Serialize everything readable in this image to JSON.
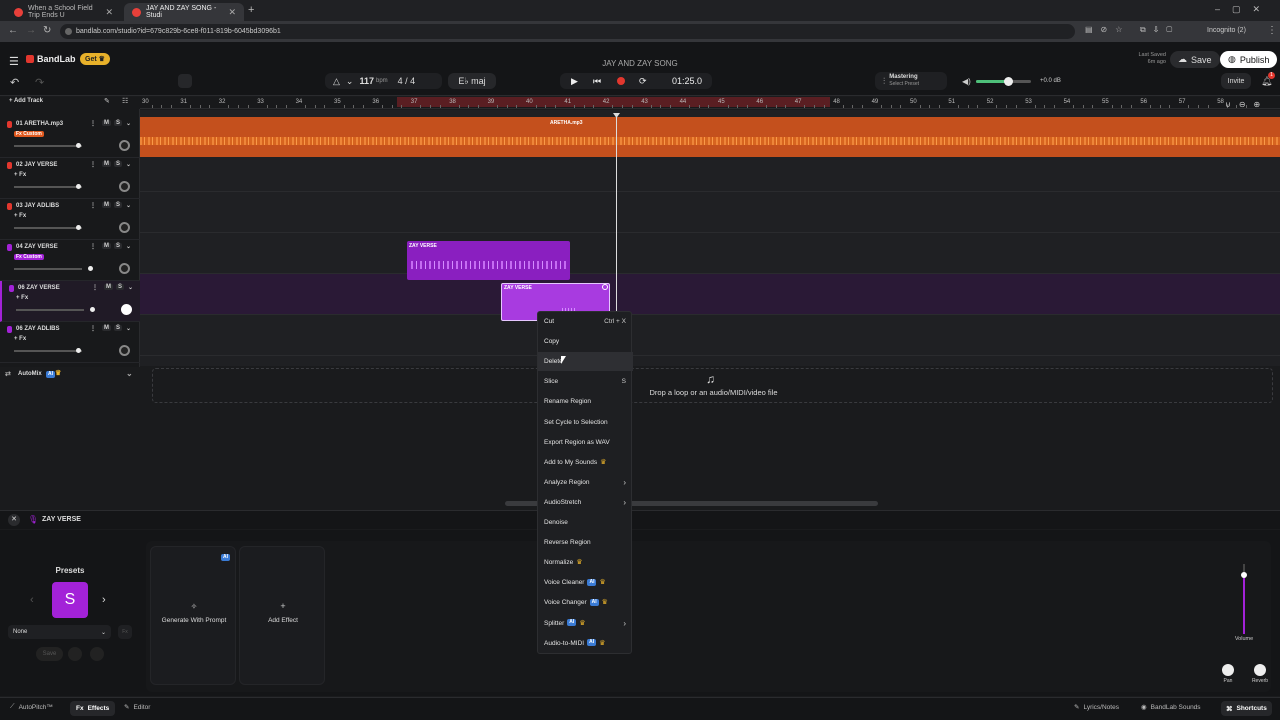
{
  "browser": {
    "tabs": [
      {
        "title": "When a School Field Trip Ends U"
      },
      {
        "title": "JAY AND ZAY SONG - Studi"
      }
    ],
    "url": "bandlab.com/studio?id=679c829b-6ce8-f011-819b-6045bd3096b1",
    "incognito": "Incognito (2)"
  },
  "header": {
    "brand": "BandLab",
    "get_label": "Get",
    "song_title": "JAY AND ZAY SONG",
    "tempo": "117",
    "tempo_unit": "bpm",
    "time_sig": "4 / 4",
    "key": "E♭ maj",
    "time": "01:25.0",
    "mastering_label": "Mastering",
    "mastering_preset": "Select Preset",
    "volume_db": "+0.0 dB",
    "last_saved_label": "Last Saved",
    "last_saved_value": "6m ago",
    "save_label": "Save",
    "publish_label": "Publish",
    "invite_label": "Invite",
    "notif_count": "1"
  },
  "add_track_label": "Add Track",
  "ruler": [
    "30",
    "31",
    "32",
    "33",
    "34",
    "35",
    "36",
    "37",
    "38",
    "39",
    "40",
    "41",
    "42",
    "43",
    "44",
    "45",
    "46",
    "47",
    "48",
    "49",
    "50",
    "51",
    "52",
    "53",
    "54",
    "55",
    "56",
    "57",
    "58"
  ],
  "tracks": [
    {
      "name": "01  ARETHA.mp3",
      "fx": "Fx Custom",
      "color": "#e0591f"
    },
    {
      "name": "02  JAY VERSE",
      "fx": "+ Fx",
      "color": "#e0591f"
    },
    {
      "name": "03  JAY ADLIBS",
      "fx": "+ Fx",
      "color": "#e0591f"
    },
    {
      "name": "04  ZAY VERSE",
      "fx": "Fx Custom",
      "color": "#a322d8"
    },
    {
      "name": "06  ZAY VERSE",
      "fx": "+ Fx",
      "color": "#a322d8"
    },
    {
      "name": "06  ZAY ADLIBS",
      "fx": "+ Fx",
      "color": "#a322d8"
    }
  ],
  "track_buttons": {
    "mute": "M",
    "solo": "S"
  },
  "regions": {
    "aretha": "ARETHA.mp3",
    "zay1": "ZAY VERSE",
    "zay2": "ZAY VERSE"
  },
  "automix": {
    "label": "AutoMix",
    "ai": "AI"
  },
  "drop_text": "Drop a loop or an audio/MIDI/video file",
  "bottom": {
    "track_title": "ZAY VERSE",
    "presets_label": "Presets",
    "preset_letter": "S",
    "preset_select": "None",
    "save_label": "Save",
    "generate_label": "Generate With Prompt",
    "add_effect_label": "Add Effect",
    "ai_badge": "AI",
    "volume_label": "Volume",
    "pan_label": "Pan",
    "reverb_label": "Reverb"
  },
  "footer": {
    "autopitch": "AutoPitch™",
    "effects": "Effects",
    "editor": "Editor",
    "lyrics": "Lyrics/Notes",
    "sounds": "BandLab Sounds",
    "shortcuts": "Shortcuts"
  },
  "context_menu": [
    {
      "label": "Cut",
      "shortcut": "Ctrl + X"
    },
    {
      "label": "Copy"
    },
    {
      "label": "Delete"
    },
    {
      "label": "Slice",
      "shortcut": "S"
    },
    {
      "label": "Rename Region"
    },
    {
      "label": "Set Cycle to Selection"
    },
    {
      "label": "Export Region as WAV"
    },
    {
      "label": "Add to My Sounds",
      "crown": true
    },
    {
      "label": "Analyze Region",
      "sub": true
    },
    {
      "label": "AudioStretch",
      "sub": true
    },
    {
      "label": "Denoise"
    },
    {
      "label": "Reverse Region"
    },
    {
      "label": "Normalize",
      "crown": true
    },
    {
      "label": "Voice Cleaner",
      "ai": "AI",
      "crown": true
    },
    {
      "label": "Voice Changer",
      "ai": "AI",
      "crown": true
    },
    {
      "label": "Splitter",
      "ai": "AI",
      "crown": true,
      "sub": true
    },
    {
      "label": "Audio-to-MIDI",
      "ai": "AI",
      "crown": true
    }
  ],
  "colors": {
    "orange": "#e0591f",
    "purple": "#a322d8",
    "record": "#e2372e",
    "ai_blue": "#3a7bd5"
  }
}
